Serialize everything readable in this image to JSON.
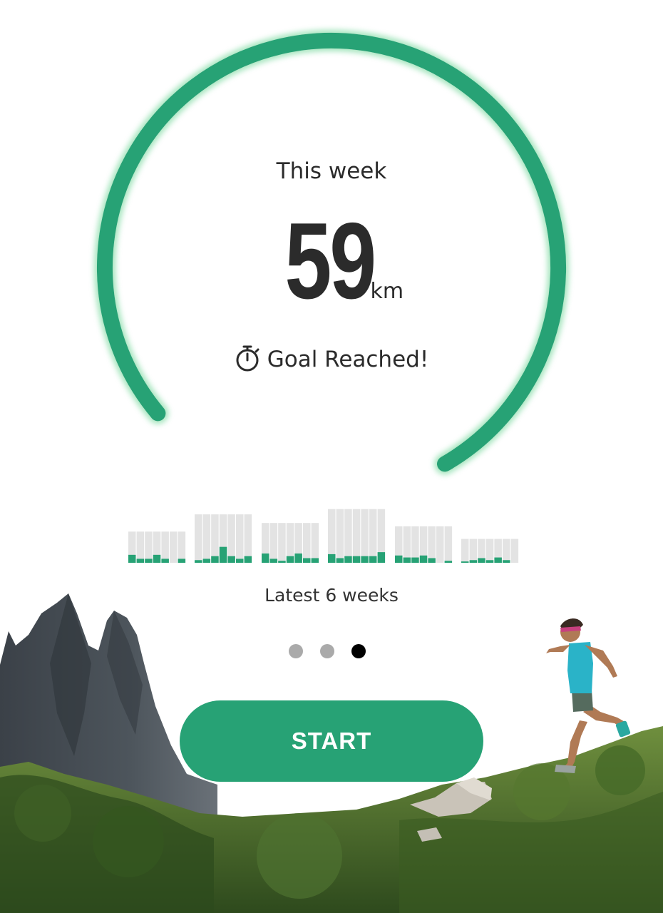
{
  "summary": {
    "period_label": "This week",
    "distance_value": "59",
    "distance_unit": "km",
    "goal_status": "Goal  Reached!",
    "goal_progress": 1.0
  },
  "history": {
    "caption": "Latest 6 weeks",
    "weeks": [
      {
        "goal": 0.47,
        "days": [
          0.12,
          0.06,
          0.06,
          0.12,
          0.06,
          0,
          0.06
        ]
      },
      {
        "goal": 0.73,
        "days": [
          0.04,
          0.06,
          0.1,
          0.24,
          0.1,
          0.06,
          0.1
        ]
      },
      {
        "goal": 0.6,
        "days": [
          0.14,
          0.06,
          0.03,
          0.1,
          0.14,
          0.07,
          0.07
        ]
      },
      {
        "goal": 0.81,
        "days": [
          0.13,
          0.07,
          0.1,
          0.1,
          0.1,
          0.1,
          0.16
        ]
      },
      {
        "goal": 0.55,
        "days": [
          0.11,
          0.08,
          0.08,
          0.11,
          0.07,
          0,
          0.03
        ]
      },
      {
        "goal": 0.36,
        "days": [
          0.02,
          0.04,
          0.07,
          0.04,
          0.08,
          0.04,
          0
        ]
      }
    ]
  },
  "pager": {
    "count": 3,
    "active_index": 2
  },
  "action": {
    "start_label": "START"
  },
  "colors": {
    "accent": "#27a275",
    "bar_track": "#e3e3e3",
    "dot_inactive": "#aaaaaa",
    "dot_active": "#000000"
  },
  "icons": {
    "goal": "stopwatch-icon"
  }
}
